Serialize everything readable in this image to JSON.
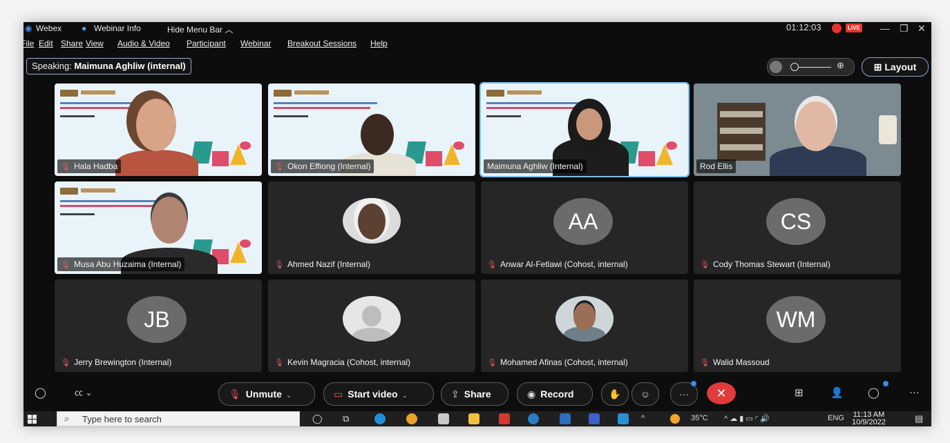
{
  "titlebar": {
    "app_name": "Webex",
    "webinar_info": "Webinar Info",
    "hide_menu": "Hide Menu Bar",
    "timer": "01:12:03",
    "live_badge": "LIVE"
  },
  "menu": [
    "File",
    "Edit",
    "Share",
    "View",
    "Audio & Video",
    "Participant",
    "Webinar",
    "Breakout Sessions",
    "Help"
  ],
  "speaking": {
    "label": "Speaking:",
    "name": "Maimuna Aghliw (internal)"
  },
  "layout_button": "Layout",
  "participants": [
    {
      "name": "Hala Hadba",
      "muted": true
    },
    {
      "name": "Okon Effiong (Internal)",
      "muted": true
    },
    {
      "name": "Maimuna Aghliw (Internal)",
      "muted": false
    },
    {
      "name": "Rod Ellis",
      "muted": false
    },
    {
      "name": "Musa Abu Huzaima (Internal)",
      "muted": true
    },
    {
      "name": "Ahmed Nazif (Internal)",
      "muted": true
    },
    {
      "name": "Anwar Al-Fetlawi (Cohost, internal)",
      "muted": true,
      "initials": "AA"
    },
    {
      "name": "Cody Thomas Stewart (Internal)",
      "muted": true,
      "initials": "CS"
    },
    {
      "name": "Jerry Brewington (Internal)",
      "muted": true,
      "initials": "JB"
    },
    {
      "name": "Kevin Magracia (Cohost, internal)",
      "muted": true
    },
    {
      "name": "Mohamed Afinas (Cohost, internal)",
      "muted": true
    },
    {
      "name": "Walid Massoud",
      "muted": true,
      "initials": "WM"
    }
  ],
  "controls": {
    "unmute": "Unmute",
    "start_video": "Start video",
    "share": "Share",
    "record": "Record"
  },
  "taskbar": {
    "search_placeholder": "Type here to search",
    "temperature": "35°C",
    "language": "ENG",
    "time": "11:13 AM",
    "date": "10/9/2022"
  }
}
